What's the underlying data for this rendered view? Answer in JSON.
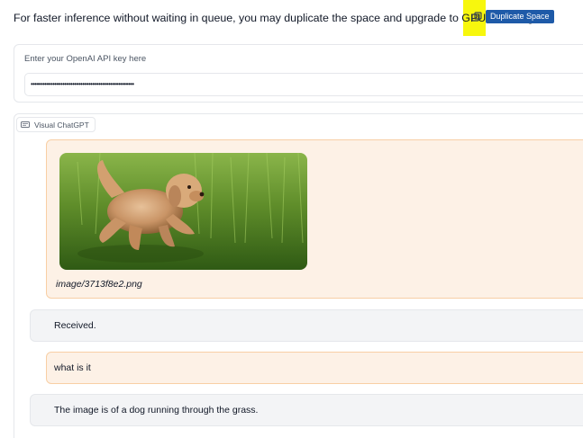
{
  "notice": {
    "text": "For faster inference without waiting in queue, you may duplicate the space and upgrade to GPU in settings.",
    "duplicate_button": "Duplicate Space",
    "duplicate_icon": "duplicate-icon"
  },
  "api": {
    "label": "Enter your OpenAI API key here",
    "value": "••••••••••••••••••••••••••••••••••••••••••••••••••••"
  },
  "chat": {
    "tab_label": "Visual ChatGPT",
    "tab_icon": "chat-icon",
    "messages": [
      {
        "role": "user",
        "image": "dog-running-photo",
        "caption": "image/3713f8e2.png"
      },
      {
        "role": "bot",
        "text": "Received."
      },
      {
        "role": "user",
        "text": "what is it"
      },
      {
        "role": "bot",
        "text": "The image is of a dog running through the grass."
      }
    ]
  },
  "colors": {
    "accent_button": "#1e5aa8",
    "user_bubble_bg": "#fdf1e6",
    "user_bubble_border": "#f8cfa5",
    "bot_bubble_bg": "#f3f4f6",
    "highlight": "#f7f700"
  }
}
